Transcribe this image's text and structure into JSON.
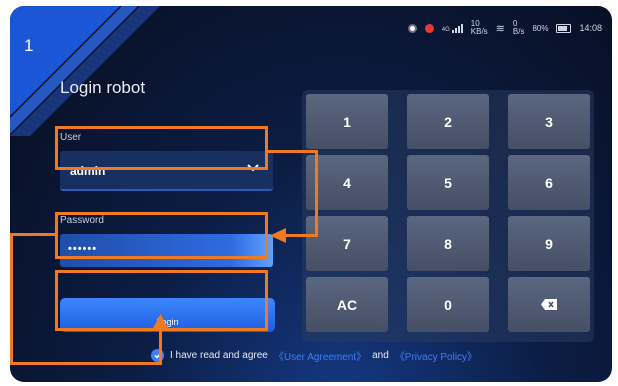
{
  "colors": {
    "accent": "#3b82f6",
    "annotation": "#f07a21",
    "link": "#3f7df0"
  },
  "corner": {
    "step_number": "1"
  },
  "status_bar": {
    "signal_label": "4G",
    "speed_1": "10",
    "speed_1_unit": "KB/s",
    "speed_2": "0",
    "speed_2_unit": "B/s",
    "battery": "80%",
    "time": "14:08"
  },
  "login": {
    "title": "Login robot",
    "user_label": "User",
    "user_value": "admin",
    "password_label": "Password",
    "password_value": "••••••",
    "login_label": "Login"
  },
  "keypad": {
    "keys": [
      "1",
      "2",
      "3",
      "4",
      "5",
      "6",
      "7",
      "8",
      "9",
      "AC",
      "0",
      "⌫"
    ]
  },
  "agreement": {
    "text": "I have read and agree",
    "user_agreement": "《User Agreement》",
    "and": "and",
    "privacy_policy": "《Privacy Policy》"
  }
}
